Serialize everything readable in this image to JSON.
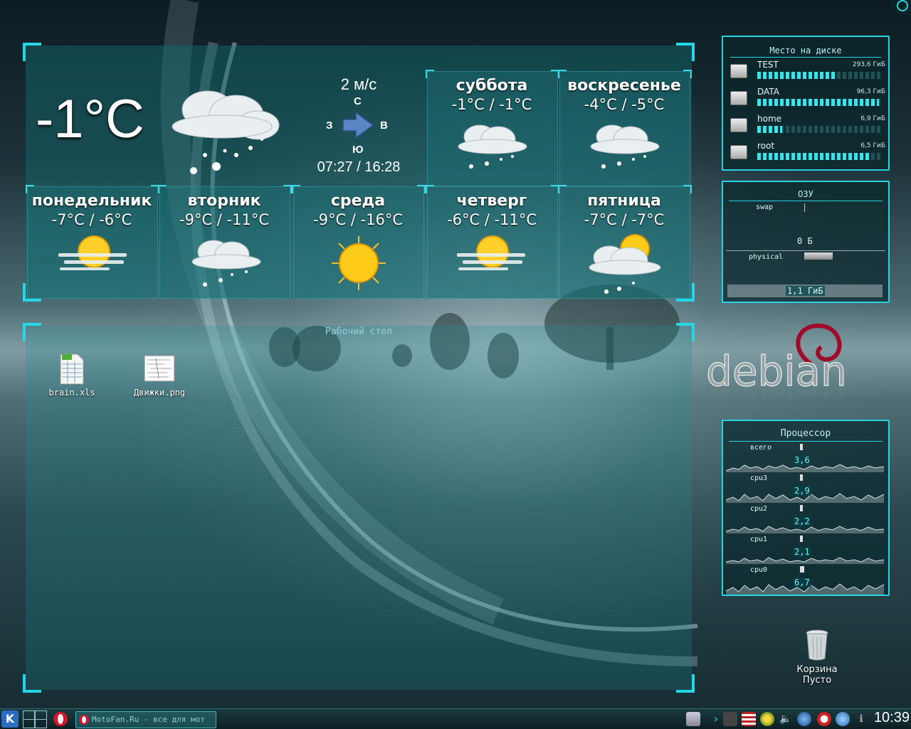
{
  "weather": {
    "current_temp": "-1°C",
    "current_icon": "snow-cloud-icon",
    "wind_speed": "2 м/с",
    "dir_n": "С",
    "dir_w": "З",
    "dir_e": "В",
    "dir_s": "Ю",
    "sun_times": "07:27 / 16:28",
    "forecast": [
      {
        "day": "суббота",
        "temp": "-1°C / -1°C",
        "icon": "snow-cloud-icon"
      },
      {
        "day": "воскресенье",
        "temp": "-4°C / -5°C",
        "icon": "snow-cloud-icon"
      },
      {
        "day": "понедельник",
        "temp": "-7°C / -6°C",
        "icon": "sun-mist-icon"
      },
      {
        "day": "вторник",
        "temp": "-9°C / -11°C",
        "icon": "snow-cloud-icon"
      },
      {
        "day": "среда",
        "temp": "-9°C / -16°C",
        "icon": "sun-icon"
      },
      {
        "day": "четверг",
        "temp": "-6°C / -11°C",
        "icon": "sun-mist-icon"
      },
      {
        "day": "пятница",
        "temp": "-7°C / -7°C",
        "icon": "sun-cloud-snow-icon"
      }
    ]
  },
  "folderview": {
    "title": "Рабочий стол",
    "items": [
      {
        "label": "brain.xls",
        "icon": "spreadsheet-file-icon"
      },
      {
        "label": "Движки.png",
        "icon": "image-file-icon"
      }
    ]
  },
  "disk": {
    "title": "Место на диске",
    "items": [
      {
        "name": "TEST",
        "size": "293,6 ГиБ",
        "used": 0.62
      },
      {
        "name": "DATA",
        "size": "96,3 ГиБ",
        "used": 0.97
      },
      {
        "name": "home",
        "size": "6,9 ГиБ",
        "used": 0.2
      },
      {
        "name": "root",
        "size": "6,5 ГиБ",
        "used": 0.9
      }
    ]
  },
  "ram": {
    "title": "ОЗУ",
    "swap_label": "swap",
    "swap_value": "0 Б",
    "physical_label": "physical",
    "physical_value": "1,1 ГиБ"
  },
  "debian_logo": "debian",
  "cpu": {
    "title": "Процессор",
    "rows": [
      {
        "label": "всего",
        "value": "3,6"
      },
      {
        "label": "cpu3",
        "value": "2,9"
      },
      {
        "label": "cpu2",
        "value": "2,2"
      },
      {
        "label": "cpu1",
        "value": "2,1"
      },
      {
        "label": "cpu0",
        "value": "6,7"
      }
    ]
  },
  "trash": {
    "title": "Корзина",
    "status": "Пусто"
  },
  "taskbar": {
    "task_label": "MotoFan.Ru - все для мот",
    "clock": "10:39",
    "colors": {
      "accent": "#27d6e6"
    }
  }
}
